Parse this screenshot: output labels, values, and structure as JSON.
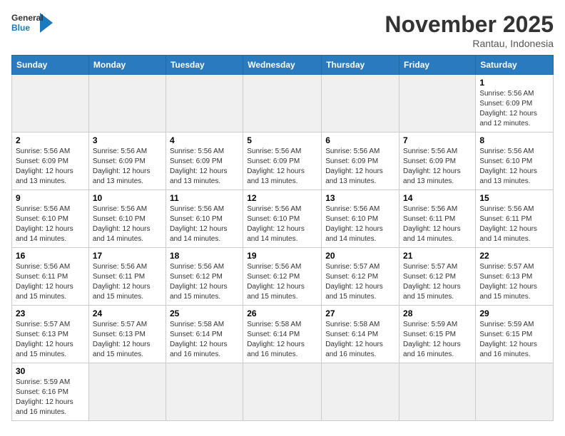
{
  "logo": {
    "text_general": "General",
    "text_blue": "Blue"
  },
  "title": "November 2025",
  "subtitle": "Rantau, Indonesia",
  "days_of_week": [
    "Sunday",
    "Monday",
    "Tuesday",
    "Wednesday",
    "Thursday",
    "Friday",
    "Saturday"
  ],
  "weeks": [
    [
      {
        "day": "",
        "info": "",
        "empty": true
      },
      {
        "day": "",
        "info": "",
        "empty": true
      },
      {
        "day": "",
        "info": "",
        "empty": true
      },
      {
        "day": "",
        "info": "",
        "empty": true
      },
      {
        "day": "",
        "info": "",
        "empty": true
      },
      {
        "day": "",
        "info": "",
        "empty": true
      },
      {
        "day": "1",
        "info": "Sunrise: 5:56 AM\nSunset: 6:09 PM\nDaylight: 12 hours and 12 minutes."
      }
    ],
    [
      {
        "day": "2",
        "info": "Sunrise: 5:56 AM\nSunset: 6:09 PM\nDaylight: 12 hours and 13 minutes."
      },
      {
        "day": "3",
        "info": "Sunrise: 5:56 AM\nSunset: 6:09 PM\nDaylight: 12 hours and 13 minutes."
      },
      {
        "day": "4",
        "info": "Sunrise: 5:56 AM\nSunset: 6:09 PM\nDaylight: 12 hours and 13 minutes."
      },
      {
        "day": "5",
        "info": "Sunrise: 5:56 AM\nSunset: 6:09 PM\nDaylight: 12 hours and 13 minutes."
      },
      {
        "day": "6",
        "info": "Sunrise: 5:56 AM\nSunset: 6:09 PM\nDaylight: 12 hours and 13 minutes."
      },
      {
        "day": "7",
        "info": "Sunrise: 5:56 AM\nSunset: 6:09 PM\nDaylight: 12 hours and 13 minutes."
      },
      {
        "day": "8",
        "info": "Sunrise: 5:56 AM\nSunset: 6:10 PM\nDaylight: 12 hours and 13 minutes."
      }
    ],
    [
      {
        "day": "9",
        "info": "Sunrise: 5:56 AM\nSunset: 6:10 PM\nDaylight: 12 hours and 14 minutes."
      },
      {
        "day": "10",
        "info": "Sunrise: 5:56 AM\nSunset: 6:10 PM\nDaylight: 12 hours and 14 minutes."
      },
      {
        "day": "11",
        "info": "Sunrise: 5:56 AM\nSunset: 6:10 PM\nDaylight: 12 hours and 14 minutes."
      },
      {
        "day": "12",
        "info": "Sunrise: 5:56 AM\nSunset: 6:10 PM\nDaylight: 12 hours and 14 minutes."
      },
      {
        "day": "13",
        "info": "Sunrise: 5:56 AM\nSunset: 6:10 PM\nDaylight: 12 hours and 14 minutes."
      },
      {
        "day": "14",
        "info": "Sunrise: 5:56 AM\nSunset: 6:11 PM\nDaylight: 12 hours and 14 minutes."
      },
      {
        "day": "15",
        "info": "Sunrise: 5:56 AM\nSunset: 6:11 PM\nDaylight: 12 hours and 14 minutes."
      }
    ],
    [
      {
        "day": "16",
        "info": "Sunrise: 5:56 AM\nSunset: 6:11 PM\nDaylight: 12 hours and 15 minutes."
      },
      {
        "day": "17",
        "info": "Sunrise: 5:56 AM\nSunset: 6:11 PM\nDaylight: 12 hours and 15 minutes."
      },
      {
        "day": "18",
        "info": "Sunrise: 5:56 AM\nSunset: 6:12 PM\nDaylight: 12 hours and 15 minutes."
      },
      {
        "day": "19",
        "info": "Sunrise: 5:56 AM\nSunset: 6:12 PM\nDaylight: 12 hours and 15 minutes."
      },
      {
        "day": "20",
        "info": "Sunrise: 5:57 AM\nSunset: 6:12 PM\nDaylight: 12 hours and 15 minutes."
      },
      {
        "day": "21",
        "info": "Sunrise: 5:57 AM\nSunset: 6:12 PM\nDaylight: 12 hours and 15 minutes."
      },
      {
        "day": "22",
        "info": "Sunrise: 5:57 AM\nSunset: 6:13 PM\nDaylight: 12 hours and 15 minutes."
      }
    ],
    [
      {
        "day": "23",
        "info": "Sunrise: 5:57 AM\nSunset: 6:13 PM\nDaylight: 12 hours and 15 minutes."
      },
      {
        "day": "24",
        "info": "Sunrise: 5:57 AM\nSunset: 6:13 PM\nDaylight: 12 hours and 15 minutes."
      },
      {
        "day": "25",
        "info": "Sunrise: 5:58 AM\nSunset: 6:14 PM\nDaylight: 12 hours and 16 minutes."
      },
      {
        "day": "26",
        "info": "Sunrise: 5:58 AM\nSunset: 6:14 PM\nDaylight: 12 hours and 16 minutes."
      },
      {
        "day": "27",
        "info": "Sunrise: 5:58 AM\nSunset: 6:14 PM\nDaylight: 12 hours and 16 minutes."
      },
      {
        "day": "28",
        "info": "Sunrise: 5:59 AM\nSunset: 6:15 PM\nDaylight: 12 hours and 16 minutes."
      },
      {
        "day": "29",
        "info": "Sunrise: 5:59 AM\nSunset: 6:15 PM\nDaylight: 12 hours and 16 minutes."
      }
    ],
    [
      {
        "day": "30",
        "info": "Sunrise: 5:59 AM\nSunset: 6:16 PM\nDaylight: 12 hours and 16 minutes."
      },
      {
        "day": "",
        "info": "",
        "empty": true
      },
      {
        "day": "",
        "info": "",
        "empty": true
      },
      {
        "day": "",
        "info": "",
        "empty": true
      },
      {
        "day": "",
        "info": "",
        "empty": true
      },
      {
        "day": "",
        "info": "",
        "empty": true
      },
      {
        "day": "",
        "info": "",
        "empty": true
      }
    ]
  ]
}
